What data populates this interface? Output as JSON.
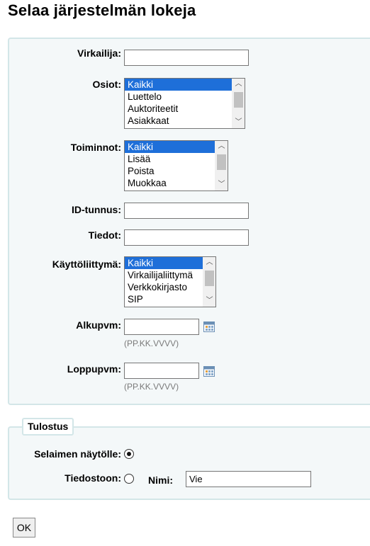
{
  "page": {
    "title": "Selaa järjestelmän lokeja"
  },
  "form": {
    "librarian": {
      "label": "Virkailija:",
      "value": ""
    },
    "modules": {
      "label": "Osiot:",
      "options": [
        "Kaikki",
        "Luettelo",
        "Auktoriteetit",
        "Asiakkaat"
      ],
      "selected": "Kaikki"
    },
    "actions": {
      "label": "Toiminnot:",
      "options": [
        "Kaikki",
        "Lisää",
        "Poista",
        "Muokkaa"
      ],
      "selected": "Kaikki"
    },
    "object": {
      "label": "ID-tunnus:",
      "value": ""
    },
    "info": {
      "label": "Tiedot:",
      "value": ""
    },
    "interface": {
      "label": "Käyttöliittymä:",
      "options": [
        "Kaikki",
        "Virkailijaliittymä",
        "Verkkokirjasto",
        "SIP"
      ],
      "selected": "Kaikki"
    },
    "from": {
      "label": "Alkupvm:",
      "value": "",
      "hint": "(PP.KK.VVVV)",
      "icon": "calendar-icon"
    },
    "to": {
      "label": "Loppupvm:",
      "value": "",
      "hint": "(PP.KK.VVVV)",
      "icon": "calendar-icon"
    }
  },
  "output": {
    "legend": "Tulostus",
    "screen": {
      "label": "Selaimen näytölle:",
      "checked": true
    },
    "file": {
      "label": "Tiedostoon:",
      "checked": false
    },
    "filename": {
      "label": "Nimi:",
      "value": "Vie"
    }
  },
  "submit": {
    "label": "OK"
  },
  "colors": {
    "selection": "#1e6fd9",
    "fieldset_border": "#d3e6e8",
    "fieldset_bg": "#f4f8f9"
  }
}
